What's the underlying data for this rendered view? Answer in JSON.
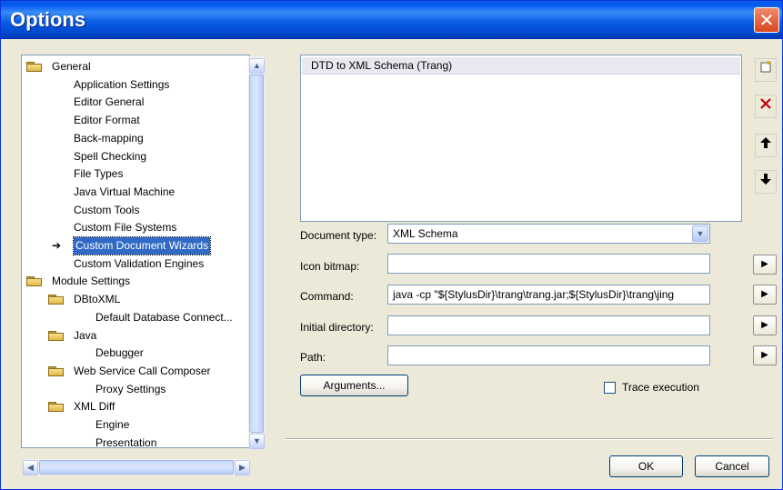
{
  "window": {
    "title": "Options",
    "close_glyph": "✕"
  },
  "tree": {
    "items": [
      {
        "label": "General",
        "folder": true,
        "level": 0
      },
      {
        "label": "Application Settings",
        "folder": false,
        "level": 1
      },
      {
        "label": "Editor General",
        "folder": false,
        "level": 1
      },
      {
        "label": "Editor Format",
        "folder": false,
        "level": 1
      },
      {
        "label": "Back-mapping",
        "folder": false,
        "level": 1
      },
      {
        "label": "Spell Checking",
        "folder": false,
        "level": 1
      },
      {
        "label": "File Types",
        "folder": false,
        "level": 1
      },
      {
        "label": "Java Virtual Machine",
        "folder": false,
        "level": 1
      },
      {
        "label": "Custom Tools",
        "folder": false,
        "level": 1
      },
      {
        "label": "Custom File Systems",
        "folder": false,
        "level": 1
      },
      {
        "label": "Custom Document Wizards",
        "folder": false,
        "level": 1,
        "selected": true
      },
      {
        "label": "Custom Validation Engines",
        "folder": false,
        "level": 1
      },
      {
        "label": "Module Settings",
        "folder": true,
        "level": 0
      },
      {
        "label": "DBtoXML",
        "folder": true,
        "level": 1
      },
      {
        "label": "Default Database Connect...",
        "folder": false,
        "level": 2
      },
      {
        "label": "Java",
        "folder": true,
        "level": 1
      },
      {
        "label": "Debugger",
        "folder": false,
        "level": 2
      },
      {
        "label": "Web Service Call Composer",
        "folder": true,
        "level": 1
      },
      {
        "label": "Proxy Settings",
        "folder": false,
        "level": 2
      },
      {
        "label": "XML Diff",
        "folder": true,
        "level": 1
      },
      {
        "label": "Engine",
        "folder": false,
        "level": 2
      },
      {
        "label": "Presentation",
        "folder": false,
        "level": 2
      }
    ],
    "scroll_up": "▲",
    "scroll_down": "▼",
    "scroll_left": "◀",
    "scroll_right": "▶"
  },
  "wizards": {
    "items": [
      "DTD to XML Schema (Trang)"
    ],
    "buttons": {
      "new": "new-icon",
      "delete": "delete-icon",
      "move_up": "arrow-up-icon",
      "move_down": "arrow-down-icon"
    }
  },
  "form": {
    "document_type_label": "Document type:",
    "document_type_value": "XML Schema",
    "icon_bitmap_label": "Icon bitmap:",
    "icon_bitmap_value": "",
    "command_label": "Command:",
    "command_value": "java -cp \"${StylusDir}\\trang\\trang.jar;${StylusDir}\\trang\\jing",
    "initial_directory_label": "Initial directory:",
    "initial_directory_value": "",
    "path_label": "Path:",
    "path_value": "",
    "arguments_button": "Arguments...",
    "trace_label": "Trace execution",
    "trace_checked": false
  },
  "footer": {
    "ok": "OK",
    "cancel": "Cancel"
  },
  "colors": {
    "titlebar": "#0a5de4",
    "selection": "#316ac5",
    "delete": "#c00000"
  }
}
